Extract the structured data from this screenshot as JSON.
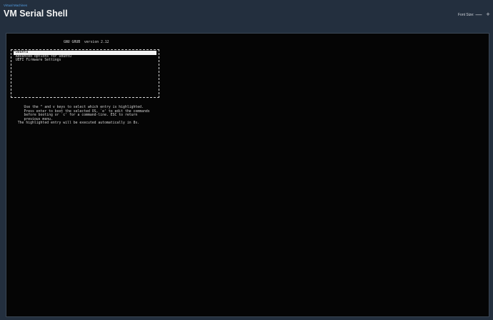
{
  "header": {
    "breadcrumb": "Virtual Machines",
    "title": "VM Serial Shell",
    "font_size_label": "Font Size:",
    "decrease_label": "—",
    "increase_label": "+"
  },
  "terminal": {
    "grub_title": "GNU GRUB  version 2.12",
    "menu_items": [
      "*Ubuntu",
      " Advanced options for Ubuntu",
      " UEFI Firmware Settings"
    ],
    "selected_index": 0,
    "help_lines": [
      "     Use the ^ and v keys to select which entry is highlighted.",
      "     Press enter to boot the selected OS, `e' to edit the commands",
      "     before booting or `c' for a command-line. ESC to return",
      "     previous menu.",
      "  The highlighted entry will be executed automatically in 8s."
    ]
  }
}
